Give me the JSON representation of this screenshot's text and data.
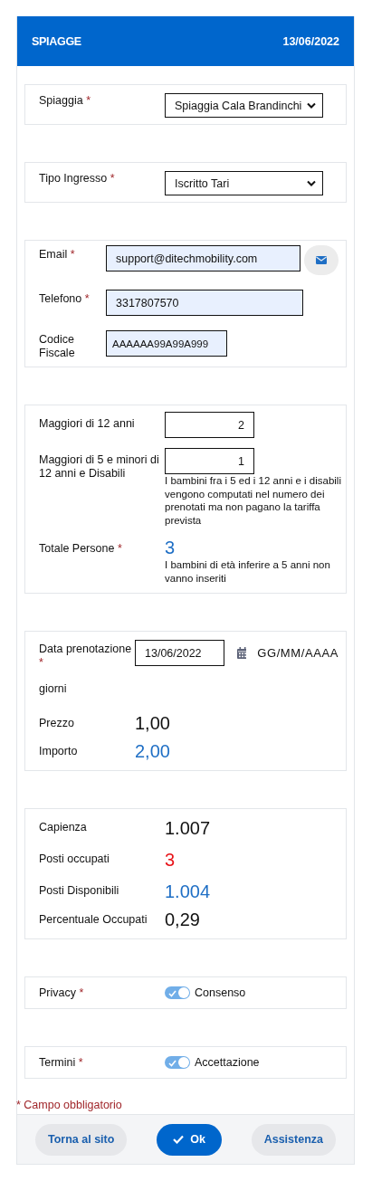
{
  "header": {
    "title": "SPIAGGE",
    "date": "13/06/2022"
  },
  "required_mark": "*",
  "sections": [
    {
      "rows": [
        {
          "kind": "select",
          "label": "Spiaggia",
          "required": true,
          "value": "Spiaggia Cala Brandinchi"
        }
      ]
    },
    {
      "rows": [
        {
          "kind": "select",
          "label": "Tipo Ingresso",
          "required": true,
          "value": "Iscritto Tari"
        }
      ]
    },
    {
      "rows": [
        {
          "kind": "input",
          "label": "Email",
          "required": true,
          "value": "support@ditechmobility.com",
          "email_button": true
        },
        {
          "kind": "input",
          "label": "Telefono",
          "required": true,
          "value": "3317807570",
          "email_button": false
        },
        {
          "kind": "short-input",
          "label": "Codice Fiscale",
          "required": false,
          "value": "AAAAAA99A99A999"
        }
      ]
    },
    {
      "rows": [
        {
          "kind": "number",
          "label": "Maggiori di 12 anni",
          "required": false,
          "value": "2"
        },
        {
          "kind": "number",
          "label": "Maggiori di 5 e minori di 12 anni e Disabili",
          "required": false,
          "value": "1",
          "note": "I bambini fra i 5 ed i 12 anni e i disabili vengono computati nel numero dei prenotati ma non pagano la tariffa prevista"
        },
        {
          "kind": "total",
          "label": "Totale Persone",
          "required": true,
          "value": "3",
          "color": "#1f6fc5",
          "note": "I bambini di età inferire a 5 anni non vanno inseriti"
        }
      ]
    },
    {
      "rows": [
        {
          "kind": "date",
          "label": "Data prenotazione",
          "required": true,
          "value": "13/06/2022",
          "format": "GG/MM/AAAA"
        },
        {
          "kind": "text",
          "label": "giorni"
        },
        {
          "kind": "amount",
          "label": "Prezzo",
          "value": "1,00",
          "color": "#111111"
        },
        {
          "kind": "amount",
          "label": "Importo",
          "value": "2,00",
          "color": "#1f6fc5"
        }
      ]
    },
    {
      "rows": [
        {
          "kind": "stat",
          "label": "Capienza",
          "value": "1.007",
          "color": "#111111"
        },
        {
          "kind": "stat",
          "label": "Posti occupati",
          "value": "3",
          "color": "#e8141a"
        },
        {
          "kind": "stat",
          "label": "Posti Disponibili",
          "value": "1.004",
          "color": "#1f6fc5"
        },
        {
          "kind": "stat",
          "label": "Percentuale Occupati",
          "value": "0,29",
          "color": "#111111"
        }
      ]
    },
    {
      "rows": [
        {
          "kind": "toggle",
          "label": "Privacy",
          "required": true,
          "on": true,
          "text": "Consenso"
        }
      ]
    },
    {
      "rows": [
        {
          "kind": "toggle",
          "label": "Termini",
          "required": true,
          "on": true,
          "text": "Accettazione"
        }
      ]
    }
  ],
  "required_note": "* Campo obbligatorio",
  "buttons": [
    {
      "kind": "secondary",
      "label": "Torna al sito"
    },
    {
      "kind": "primary",
      "label": "Ok"
    },
    {
      "kind": "secondary",
      "label": "Assistenza"
    }
  ]
}
